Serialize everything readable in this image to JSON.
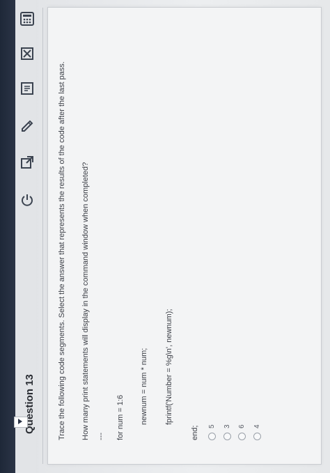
{
  "question": {
    "title": "Question 13",
    "instruction": "Trace the following code segments. Select the answer that represents the results of the code after the last pass.",
    "prompt": "How many print statements will display in the command window when completed?",
    "separator": "---",
    "code": [
      "for num = 1:6",
      "newnum = num * num;",
      "fprintf('Number = %g\\n', newnum);",
      "end;"
    ],
    "options": [
      "5",
      "3",
      "6",
      "4"
    ]
  },
  "colors": {
    "accent": "#2b3446",
    "card": "#f3f4f5",
    "text": "#3d4048"
  },
  "icons": [
    "calculator-icon",
    "close-box-icon",
    "document-icon",
    "pencil-icon",
    "external-link-icon",
    "power-icon"
  ]
}
